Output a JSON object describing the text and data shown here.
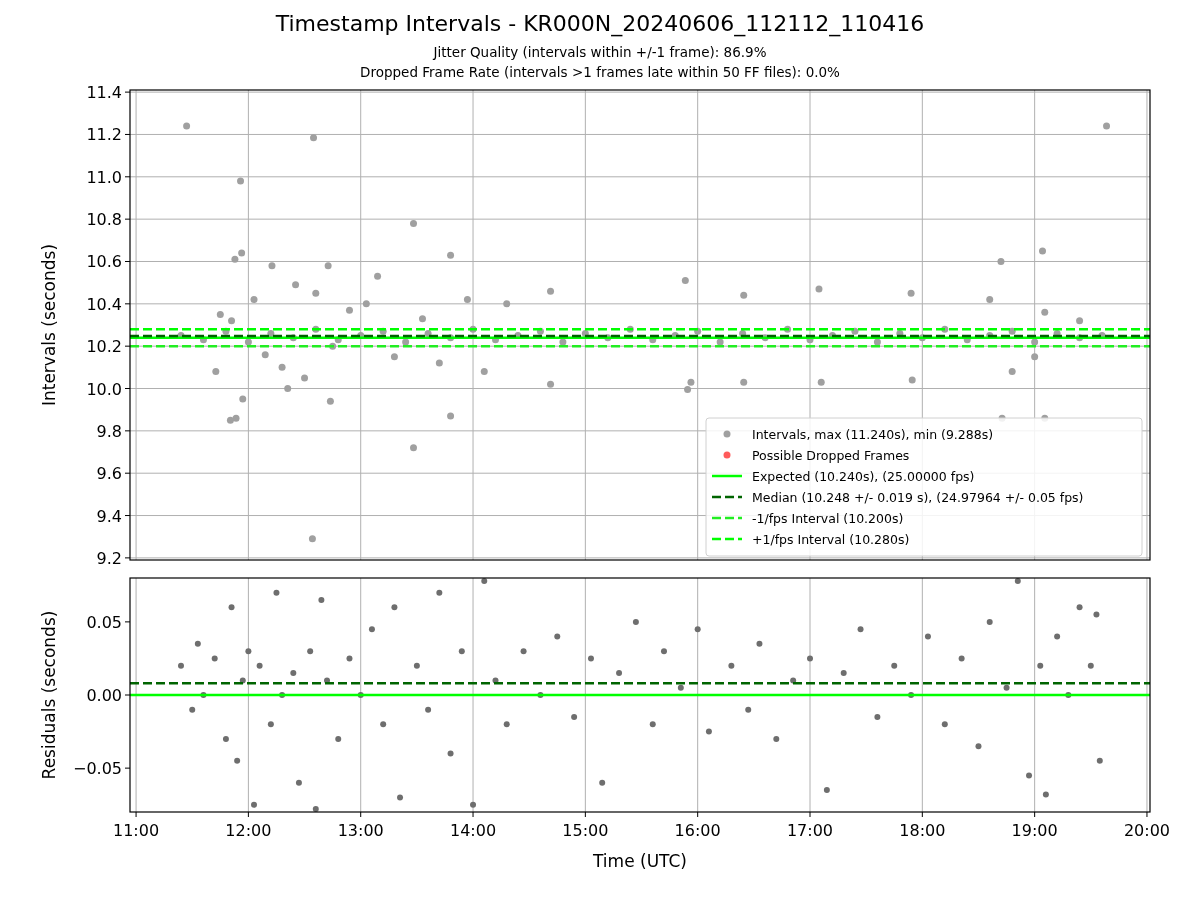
{
  "title": "Timestamp Intervals - KR000N_20240606_112112_110416",
  "subtitles": [
    "Jitter Quality (intervals within +/-1 frame): 86.9%",
    "Dropped Frame Rate (intervals >1 frames late within 50 FF files): 0.0%"
  ],
  "charts": [
    {
      "chart_data": {
        "type": "scatter",
        "grid": true,
        "legend": "lower right",
        "ylabel": "Intervals (seconds)",
        "xlim": [
          10.946,
          20.027
        ],
        "ylim": [
          9.19,
          11.41
        ],
        "yticks": [
          {
            "value": 9.2,
            "label": "9.2"
          },
          {
            "value": 9.4,
            "label": "9.4"
          },
          {
            "value": 9.6,
            "label": "9.6"
          },
          {
            "value": 9.8,
            "label": "9.8"
          },
          {
            "value": 10.0,
            "label": "10.0"
          },
          {
            "value": 10.2,
            "label": "10.2"
          },
          {
            "value": 10.4,
            "label": "10.4"
          },
          {
            "value": 10.6,
            "label": "10.6"
          },
          {
            "value": 10.8,
            "label": "10.8"
          },
          {
            "value": 11.0,
            "label": "11.0"
          },
          {
            "value": 11.2,
            "label": "11.2"
          },
          {
            "value": 11.4,
            "label": "11.4"
          }
        ],
        "series": [
          {
            "name": "Intervals, max (11.240s), min (9.288s)",
            "color": "#a0a0a0",
            "x": [
              11.4,
              11.6,
              11.8,
              12.0,
              12.2,
              12.4,
              12.6,
              12.8,
              13.0,
              13.2,
              13.4,
              13.6,
              13.8,
              14.0,
              14.2,
              14.4,
              14.6,
              14.8,
              15.0,
              15.2,
              15.4,
              15.6,
              15.8,
              16.0,
              16.2,
              16.4,
              16.6,
              16.8,
              17.0,
              17.2,
              17.4,
              17.6,
              17.8,
              18.0,
              18.2,
              18.4,
              18.6,
              18.8,
              19.0,
              19.2,
              19.4,
              19.6,
              11.45,
              12.58,
              11.93,
              13.47,
              13.8,
              11.94,
              12.21,
              12.71,
              11.88,
              13.15,
              12.42,
              14.69,
              15.89,
              16.41,
              17.08,
              17.9,
              18.7,
              19.07,
              11.71,
              11.84,
              11.89,
              12.73,
              13.8,
              13.47,
              12.57,
              14.69,
              15.91,
              15.94,
              16.41,
              17.1,
              17.91,
              18.71,
              19.09,
              19.09,
              11.75,
              11.85,
              12.05,
              12.15,
              12.3,
              12.5,
              12.75,
              12.9,
              13.05,
              13.3,
              13.55,
              13.7,
              13.95,
              14.1,
              14.3,
              12.35,
              11.95,
              12.6,
              19.0,
              18.8,
              18.6,
              19.4,
              19.64
            ],
            "values": [
              10.25,
              10.23,
              10.27,
              10.22,
              10.26,
              10.24,
              10.28,
              10.23,
              10.25,
              10.27,
              10.22,
              10.26,
              10.24,
              10.28,
              10.23,
              10.25,
              10.27,
              10.22,
              10.26,
              10.24,
              10.28,
              10.23,
              10.25,
              10.27,
              10.22,
              10.26,
              10.24,
              10.28,
              10.23,
              10.25,
              10.27,
              10.22,
              10.26,
              10.24,
              10.28,
              10.23,
              10.25,
              10.27,
              10.22,
              10.26,
              10.24,
              10.25,
              11.24,
              11.185,
              10.98,
              10.78,
              10.63,
              10.64,
              10.58,
              10.58,
              10.61,
              10.53,
              10.49,
              10.46,
              10.51,
              10.44,
              10.47,
              10.45,
              10.6,
              10.65,
              10.08,
              9.85,
              9.86,
              9.94,
              9.87,
              9.72,
              9.29,
              10.02,
              9.995,
              10.03,
              10.03,
              10.03,
              10.04,
              9.86,
              9.86,
              10.36,
              10.35,
              10.32,
              10.42,
              10.16,
              10.1,
              10.05,
              10.2,
              10.37,
              10.4,
              10.15,
              10.33,
              10.12,
              10.42,
              10.08,
              10.4,
              10.0,
              9.95,
              10.45,
              10.15,
              10.08,
              10.42,
              10.32,
              11.24
            ]
          },
          {
            "name": "Possible Dropped Frames",
            "color": "#ff5b5b"
          }
        ],
        "ref_lines": [
          {
            "axis": "y",
            "label": "Expected (10.240s), (25.00000 fps)",
            "color": "#00ff00",
            "value": 10.24
          },
          {
            "axis": "y",
            "label": "Median (10.248 +/- 0.019 s), (24.97964 +/- 0.05 fps)",
            "color": "#006400",
            "value": 10.248
          },
          {
            "axis": "y",
            "label": "-1/fps Interval (10.200s)",
            "color": "#22ee22",
            "value": 10.2
          },
          {
            "axis": "y",
            "label": "+1/fps Interval (10.280s)",
            "color": "#00ff00",
            "value": 10.28
          }
        ]
      }
    },
    {
      "chart_data": {
        "type": "scatter",
        "grid": true,
        "xlabel": "Time (UTC)",
        "ylabel": "Residuals (seconds)",
        "xlim": [
          10.946,
          20.027
        ],
        "ylim": [
          -0.08,
          0.08
        ],
        "xticks": [
          {
            "value": 11,
            "label": "11:00"
          },
          {
            "value": 12,
            "label": "12:00"
          },
          {
            "value": 13,
            "label": "13:00"
          },
          {
            "value": 14,
            "label": "14:00"
          },
          {
            "value": 15,
            "label": "15:00"
          },
          {
            "value": 16,
            "label": "16:00"
          },
          {
            "value": 17,
            "label": "17:00"
          },
          {
            "value": 18,
            "label": "18:00"
          },
          {
            "value": 19,
            "label": "19:00"
          },
          {
            "value": 20,
            "label": "20:00"
          }
        ],
        "yticks": [
          {
            "value": -0.05,
            "label": "−0.05"
          },
          {
            "value": 0,
            "label": "0.00"
          },
          {
            "value": 0.05,
            "label": "0.05"
          }
        ],
        "series": [
          {
            "color": "#6e6e6e",
            "x": [
              11.4,
              11.5,
              11.55,
              11.6,
              11.7,
              11.8,
              11.85,
              11.9,
              11.95,
              12.0,
              12.05,
              12.1,
              12.2,
              12.25,
              12.3,
              12.4,
              12.45,
              12.55,
              12.6,
              12.65,
              12.7,
              12.8,
              12.9,
              13.0,
              13.1,
              13.2,
              13.3,
              13.35,
              13.5,
              13.6,
              13.7,
              13.8,
              13.9,
              14.0,
              14.1,
              14.2,
              14.3,
              14.45,
              14.6,
              14.75,
              14.9,
              15.05,
              15.15,
              15.3,
              15.45,
              15.6,
              15.7,
              15.85,
              16.0,
              16.1,
              16.3,
              16.45,
              16.55,
              16.7,
              16.85,
              17.0,
              17.15,
              17.3,
              17.45,
              17.6,
              17.75,
              17.9,
              18.05,
              18.2,
              18.35,
              18.5,
              18.6,
              18.75,
              18.85,
              18.95,
              19.05,
              19.1,
              19.2,
              19.3,
              19.4,
              19.5,
              19.58,
              19.55
            ],
            "values": [
              0.02,
              -0.01,
              0.035,
              0.0,
              0.025,
              -0.03,
              0.06,
              -0.045,
              0.01,
              0.03,
              -0.075,
              0.02,
              -0.02,
              0.07,
              0.0,
              0.015,
              -0.06,
              0.03,
              -0.078,
              0.065,
              0.01,
              -0.03,
              0.025,
              0.0,
              0.045,
              -0.02,
              0.06,
              -0.07,
              0.02,
              -0.01,
              0.07,
              -0.04,
              0.03,
              -0.075,
              0.078,
              0.01,
              -0.02,
              0.03,
              0.0,
              0.04,
              -0.015,
              0.025,
              -0.06,
              0.015,
              0.05,
              -0.02,
              0.03,
              0.005,
              0.045,
              -0.025,
              0.02,
              -0.01,
              0.035,
              -0.03,
              0.01,
              0.025,
              -0.065,
              0.015,
              0.045,
              -0.015,
              0.02,
              0.0,
              0.04,
              -0.02,
              0.025,
              -0.035,
              0.05,
              0.005,
              0.078,
              -0.055,
              0.02,
              -0.068,
              0.04,
              0.0,
              0.06,
              0.02,
              -0.045,
              0.055
            ]
          }
        ],
        "ref_lines": [
          {
            "axis": "y",
            "color": "#00ff00",
            "value": 0
          },
          {
            "axis": "y",
            "color": "#006400",
            "value": 0.008
          }
        ]
      }
    }
  ]
}
